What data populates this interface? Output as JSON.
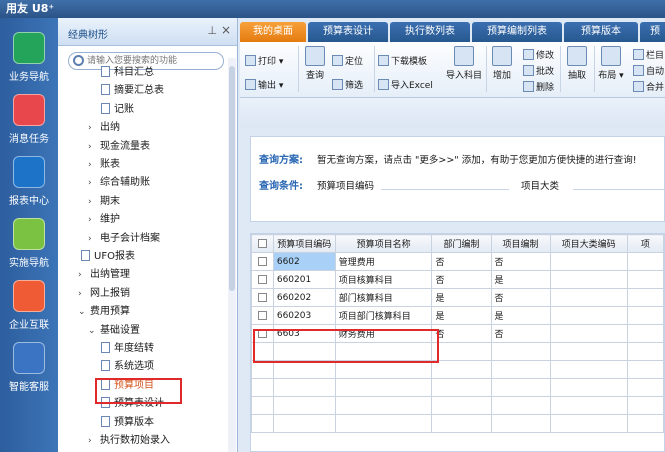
{
  "app": {
    "title": "用友 U8⁺"
  },
  "left_nav": [
    {
      "label": "业务导航",
      "icon": "business-nav-icon",
      "color": "#23a45a"
    },
    {
      "label": "消息任务",
      "icon": "message-icon",
      "color": "#e8484b"
    },
    {
      "label": "报表中心",
      "icon": "report-icon",
      "color": "#1c73c8"
    },
    {
      "label": "实施导航",
      "icon": "compass-icon",
      "color": "#7cc242"
    },
    {
      "label": "企业互联",
      "icon": "connect-icon",
      "color": "#ef5b34"
    },
    {
      "label": "智能客服",
      "icon": "service-icon",
      "color": "#3a74c3"
    }
  ],
  "tree": {
    "title": "经典树形",
    "pin_icon": "pin-icon",
    "close_icon": "close-icon",
    "search_placeholder": "请输入您要搜索的功能",
    "items": [
      {
        "label": "科目汇总",
        "level": 4,
        "type": "doc"
      },
      {
        "label": "摘要汇总表",
        "level": 4,
        "type": "doc"
      },
      {
        "label": "记账",
        "level": 4,
        "type": "doc"
      },
      {
        "label": "出纳",
        "level": 3,
        "type": "folder"
      },
      {
        "label": "现金流量表",
        "level": 3,
        "type": "folder"
      },
      {
        "label": "账表",
        "level": 3,
        "type": "folder"
      },
      {
        "label": "综合辅助账",
        "level": 3,
        "type": "folder"
      },
      {
        "label": "期末",
        "level": 3,
        "type": "folder"
      },
      {
        "label": "维护",
        "level": 3,
        "type": "folder"
      },
      {
        "label": "电子会计档案",
        "level": 3,
        "type": "folder"
      },
      {
        "label": "UFO报表",
        "level": 2,
        "type": "doc"
      },
      {
        "label": "出纳管理",
        "level": 2,
        "type": "folder"
      },
      {
        "label": "网上报销",
        "level": 2,
        "type": "folder"
      },
      {
        "label": "费用预算",
        "level": 2,
        "type": "open"
      },
      {
        "label": "基础设置",
        "level": 3,
        "type": "open"
      },
      {
        "label": "年度结转",
        "level": 4,
        "type": "doc"
      },
      {
        "label": "系统选项",
        "level": 4,
        "type": "doc"
      },
      {
        "label": "预算项目",
        "level": 4,
        "type": "doc",
        "selected": true
      },
      {
        "label": "预算表设计",
        "level": 4,
        "type": "doc"
      },
      {
        "label": "预算版本",
        "level": 4,
        "type": "doc"
      },
      {
        "label": "执行数初始录入",
        "level": 3,
        "type": "folder"
      }
    ]
  },
  "tabs": [
    "我的桌面",
    "预算表设计",
    "执行数列表",
    "预算编制列表",
    "预算版本",
    "预"
  ],
  "toolbar": {
    "print": "打印",
    "export": "输出",
    "query": "查询",
    "locate": "定位",
    "filter": "筛选",
    "download_template": "下载模板",
    "import_excel": "导入Excel",
    "import_subject": "导入科目",
    "add": "增加",
    "modify": "修改",
    "batch_modify": "批改",
    "delete": "删除",
    "extract": "抽取",
    "layout": "布局",
    "column": "栏目",
    "auto": "自动",
    "merge": "合并"
  },
  "query": {
    "scheme_label": "查询方案:",
    "scheme_hint": "暂无查询方案，请点击 \"更多>>\" 添加，有助于您更加方便快捷的进行查询!",
    "condition_label": "查询条件:",
    "cond1": "预算项目编码",
    "cond2": "项目大类"
  },
  "table": {
    "columns": [
      "预算项目编码",
      "预算项目名称",
      "部门编制",
      "项目编制",
      "项目大类编码",
      "项"
    ],
    "rows": [
      [
        "6602",
        "管理费用",
        "否",
        "否",
        "",
        ""
      ],
      [
        "660201",
        "项目核算科目",
        "否",
        "是",
        "",
        ""
      ],
      [
        "660202",
        "部门核算科目",
        "是",
        "否",
        "",
        ""
      ],
      [
        "660203",
        "项目部门核算科目",
        "是",
        "是",
        "",
        ""
      ],
      [
        "6603",
        "财务费用",
        "否",
        "否",
        "",
        ""
      ]
    ]
  }
}
